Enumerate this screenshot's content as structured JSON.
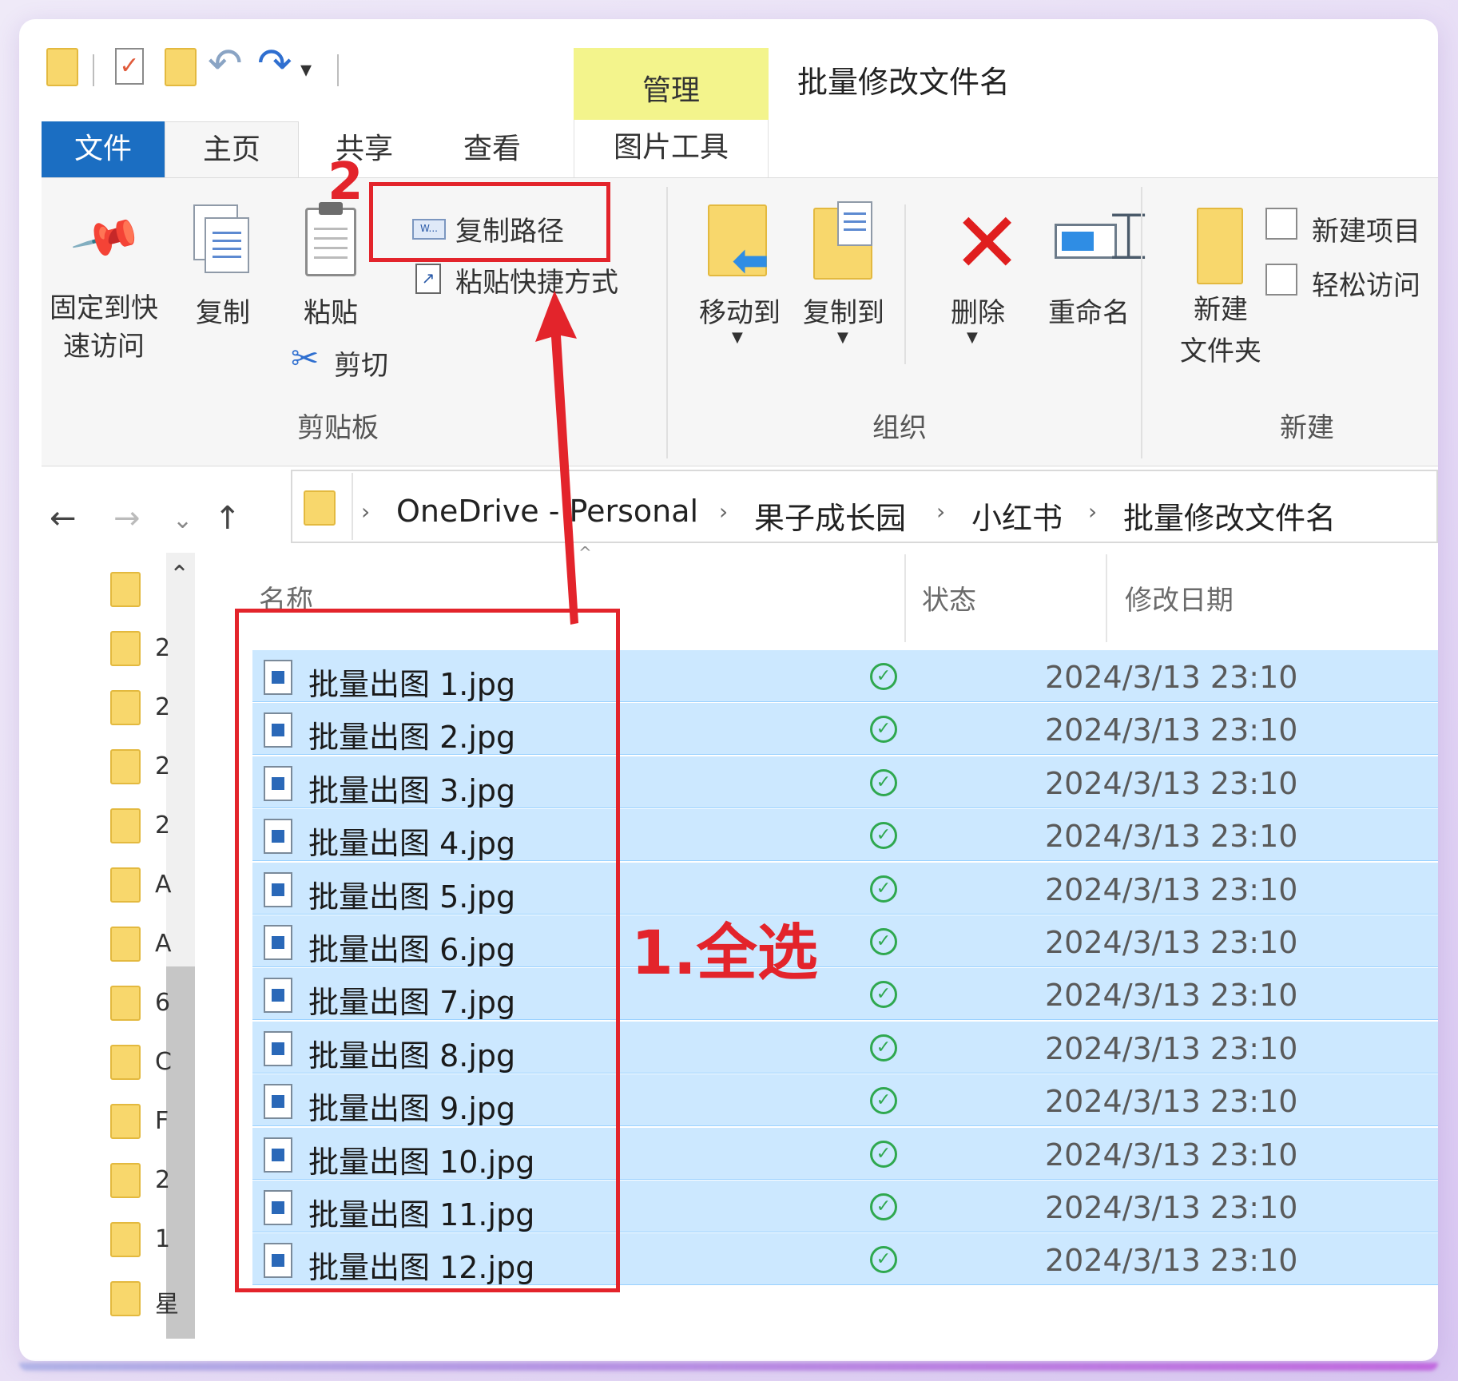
{
  "window_title": "批量修改文件名",
  "context_tab": {
    "top": "管理",
    "bottom": "图片工具"
  },
  "tabs": [
    "文件",
    "主页",
    "共享",
    "查看"
  ],
  "ribbon": {
    "clipboard": {
      "group": "剪贴板",
      "pin": "固定到快\n速访问",
      "copy": "复制",
      "paste": "粘贴",
      "copy_path": "复制路径",
      "paste_shortcut": "粘贴快捷方式",
      "cut": "剪切"
    },
    "organize": {
      "group": "组织",
      "move_to": "移动到",
      "copy_to": "复制到",
      "delete": "删除",
      "rename": "重命名"
    },
    "new": {
      "group": "新建",
      "new_folder": "新建\n文件夹",
      "new_item": "新建项目",
      "easy_access": "轻松访问"
    }
  },
  "breadcrumb": [
    "OneDrive - Personal",
    "果子成长园",
    "小红书",
    "批量修改文件名"
  ],
  "nav_pane_initials": [
    "",
    "2",
    "2",
    "2",
    "2",
    "A",
    "A",
    "6",
    "C",
    "F",
    "2",
    "1",
    "星"
  ],
  "columns": {
    "name": "名称",
    "status": "状态",
    "date": "修改日期"
  },
  "files": [
    {
      "name": "批量出图 1.jpg",
      "date": "2024/3/13 23:10"
    },
    {
      "name": "批量出图 2.jpg",
      "date": "2024/3/13 23:10"
    },
    {
      "name": "批量出图 3.jpg",
      "date": "2024/3/13 23:10"
    },
    {
      "name": "批量出图 4.jpg",
      "date": "2024/3/13 23:10"
    },
    {
      "name": "批量出图 5.jpg",
      "date": "2024/3/13 23:10"
    },
    {
      "name": "批量出图 6.jpg",
      "date": "2024/3/13 23:10"
    },
    {
      "name": "批量出图 7.jpg",
      "date": "2024/3/13 23:10"
    },
    {
      "name": "批量出图 8.jpg",
      "date": "2024/3/13 23:10"
    },
    {
      "name": "批量出图 9.jpg",
      "date": "2024/3/13 23:10"
    },
    {
      "name": "批量出图 10.jpg",
      "date": "2024/3/13 23:10"
    },
    {
      "name": "批量出图 11.jpg",
      "date": "2024/3/13 23:10"
    },
    {
      "name": "批量出图 12.jpg",
      "date": "2024/3/13 23:10"
    }
  ],
  "annotations": {
    "step1": "1.全选",
    "step2": "2"
  },
  "icons": {
    "status_synced": "check-circle-icon",
    "delete": "red-x-icon",
    "back": "←",
    "forward": "→",
    "recent": "⌄",
    "up": "↑",
    "chevron": "›",
    "sort": "^"
  },
  "colors": {
    "selection": "#cce8ff",
    "file_tab": "#1b6ec2",
    "context_tab": "#f3f48c",
    "annotation": "#e3242b",
    "synced": "#2fa84f"
  }
}
